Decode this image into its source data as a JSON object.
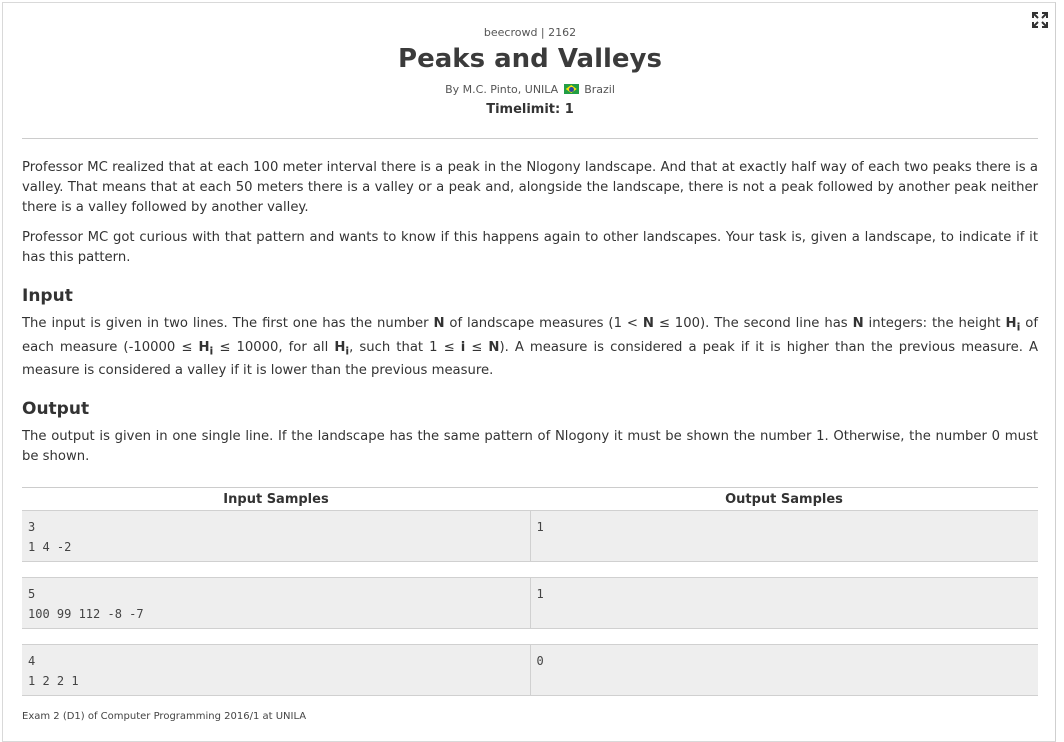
{
  "header": {
    "origin": "beecrowd | 2162",
    "title": "Peaks and Valleys",
    "author_prefix": "By M.C. Pinto, UNILA",
    "country": "Brazil",
    "timelimit": "Timelimit: 1"
  },
  "description": [
    "Professor MC realized that at each 100 meter interval there is a peak in the Nlogony landscape. And that at exactly half way of each two peaks there is a valley. That means that at each 50 meters there is a valley or a peak and, alongside the landscape, there is not a peak followed by another peak neither there is a valley followed by another valley.",
    "Professor MC got curious with that pattern and wants to know if this happens again to other landscapes. Your task is, given a landscape, to indicate if it has this pattern."
  ],
  "input": {
    "heading": "Input",
    "t1": "The input is given in two lines. The first one has the number ",
    "N": "N",
    "t2": " of landscape measures (1 < ",
    "t3": " ≤ 100). The second line has ",
    "t4": " integers: the height ",
    "H": "H",
    "i": "i",
    "t5": " of each measure (-10000 ≤ ",
    "t6": " ≤ 10000, for all ",
    "t7": ", such that 1 ≤ ",
    "t8": " ≤ ",
    "t9": "). A measure is considered a peak if it is higher than the previous measure. A measure is considered a valley if it is lower than the previous measure."
  },
  "output": {
    "heading": "Output",
    "text": "The output is given in one single line. If the landscape has the same pattern of Nlogony it must be shown the number 1. Otherwise, the number 0 must be shown."
  },
  "samples": {
    "input_header": "Input Samples",
    "output_header": "Output Samples",
    "rows": [
      {
        "input": "3\n1 4 -2",
        "output": "1"
      },
      {
        "input": "5\n100 99 112 -8 -7",
        "output": "1"
      },
      {
        "input": "4\n1 2 2 1",
        "output": "0"
      }
    ]
  },
  "footer": "Exam 2 (D1) of Computer Programming 2016/1 at UNILA",
  "icons": {
    "expand": "expand-fullscreen-icon"
  },
  "colors": {
    "text": "#333333",
    "sample_bg": "#eeeeee",
    "rule": "#cccccc"
  }
}
